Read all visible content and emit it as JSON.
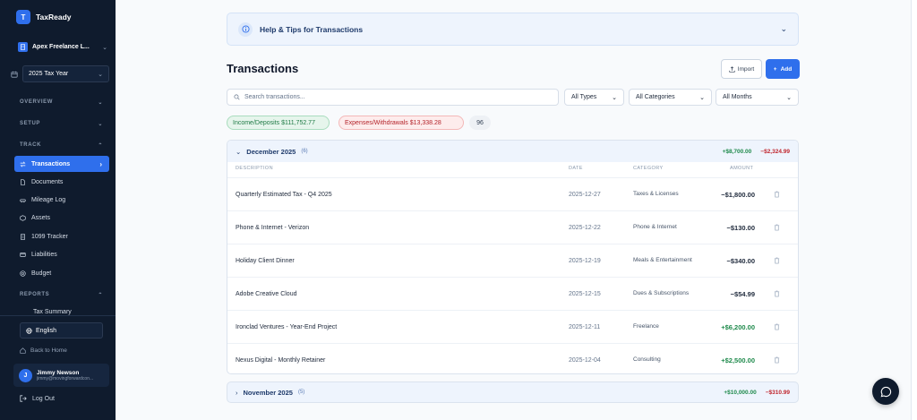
{
  "brand": {
    "logo_letter": "T",
    "name": "TaxReady"
  },
  "org": {
    "name": "Apex Freelance L..."
  },
  "tax_year": {
    "selected": "2025 Tax Year"
  },
  "sections": {
    "overview": "OVERVIEW",
    "setup": "SETUP",
    "track": "TRACK",
    "reports": "REPORTS"
  },
  "nav": {
    "transactions": "Transactions",
    "documents": "Documents",
    "mileage": "Mileage Log",
    "assets": "Assets",
    "tracker_1099": "1099 Tracker",
    "liabilities": "Liabilities",
    "budget": "Budget",
    "tax_summary": "Tax Summary"
  },
  "language": "English",
  "back_home": "Back to Home",
  "user": {
    "initial": "J",
    "name": "Jimmy Newson",
    "email": "jimmy@movingforwardcon..."
  },
  "logout": "Log Out",
  "help": {
    "title": "Help & Tips for Transactions"
  },
  "page_title": "Transactions",
  "buttons": {
    "import": "Import",
    "add": "Add"
  },
  "search": {
    "placeholder": "Search transactions..."
  },
  "filters": {
    "types": "All Types",
    "categories": "All Categories",
    "months": "All Months"
  },
  "chips": {
    "income": "Income/Deposits $111,752.77",
    "expense": "Expenses/Withdrawals $13,338.28",
    "count": "96"
  },
  "columns": {
    "description": "DESCRIPTION",
    "date": "DATE",
    "category": "CATEGORY",
    "amount": "AMOUNT"
  },
  "months": [
    {
      "name": "December 2025",
      "count": "(6)",
      "income": "+$8,700.00",
      "expense": "−$2,324.99",
      "rows": [
        {
          "description": "Quarterly Estimated Tax - Q4 2025",
          "date": "2025-12-27",
          "category": "Taxes & Licenses",
          "amount": "−$1,800.00"
        },
        {
          "description": "Phone & Internet - Verizon",
          "date": "2025-12-22",
          "category": "Phone & Internet",
          "amount": "−$130.00"
        },
        {
          "description": "Holiday Client Dinner",
          "date": "2025-12-19",
          "category": "Meals & Entertainment",
          "amount": "−$340.00"
        },
        {
          "description": "Adobe Creative Cloud",
          "date": "2025-12-15",
          "category": "Dues & Subscriptions",
          "amount": "−$54.99"
        },
        {
          "description": "Ironclad Ventures - Year-End Project",
          "date": "2025-12-11",
          "category": "Freelance",
          "amount": "+$6,200.00"
        },
        {
          "description": "Nexus Digital - Monthly Retainer",
          "date": "2025-12-04",
          "category": "Consulting",
          "amount": "+$2,500.00"
        }
      ]
    },
    {
      "name": "November 2025",
      "count": "(5)",
      "income": "+$10,000.00",
      "expense": "−$310.99"
    }
  ],
  "colors": {
    "accent": "#2f6fec",
    "sidebar": "#0f1b2d",
    "income": "#1f8a4c",
    "expense": "#c0262e"
  }
}
